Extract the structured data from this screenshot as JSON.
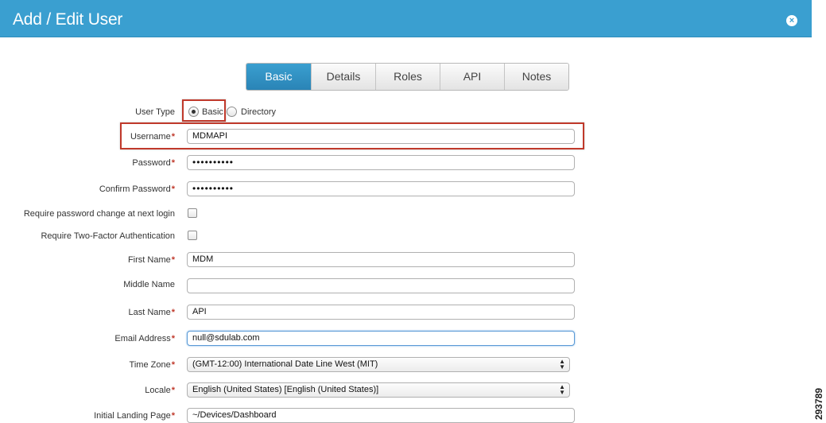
{
  "dialog": {
    "title": "Add / Edit User",
    "close_icon": "×"
  },
  "tabs": [
    {
      "label": "Basic",
      "active": true
    },
    {
      "label": "Details",
      "active": false
    },
    {
      "label": "Roles",
      "active": false
    },
    {
      "label": "API",
      "active": false
    },
    {
      "label": "Notes",
      "active": false
    }
  ],
  "form": {
    "required_marker": "*",
    "user_type": {
      "label": "User Type",
      "option_basic": "Basic",
      "option_directory": "Directory",
      "selected": "Basic"
    },
    "username": {
      "label": "Username",
      "value": "MDMAPI"
    },
    "password": {
      "label": "Password",
      "value": "••••••••••"
    },
    "confirm_password": {
      "label": "Confirm Password",
      "value": "••••••••••"
    },
    "require_pw_change": {
      "label": "Require password change at next login",
      "checked": false
    },
    "require_2fa": {
      "label": "Require Two-Factor Authentication",
      "checked": false
    },
    "first_name": {
      "label": "First Name",
      "value": "MDM"
    },
    "middle_name": {
      "label": "Middle Name",
      "value": ""
    },
    "last_name": {
      "label": "Last Name",
      "value": "API"
    },
    "email": {
      "label": "Email Address",
      "value": "null@sdulab.com"
    },
    "time_zone": {
      "label": "Time Zone",
      "value": "(GMT-12:00) International Date Line West (MIT)"
    },
    "locale": {
      "label": "Locale",
      "value": "English (United States) [English (United States)]"
    },
    "landing_page": {
      "label": "Initial Landing Page",
      "value": "~/Devices/Dashboard"
    }
  },
  "figure_id": "293789",
  "colors": {
    "header": "#3a9fd0",
    "required": "#c0392b",
    "highlight": "#c0392b"
  }
}
